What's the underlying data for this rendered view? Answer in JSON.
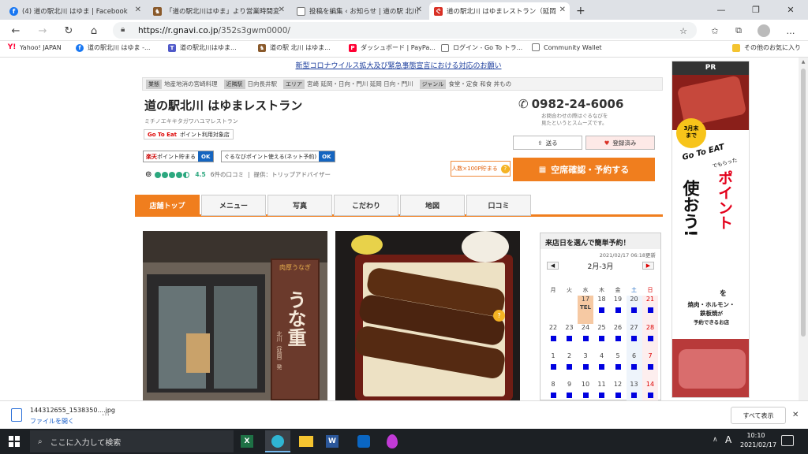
{
  "browser": {
    "tabs": [
      {
        "label": "(4) 道の駅北川 はゆま | Facebook",
        "icon": "facebook-icon",
        "color": "#1877f2"
      },
      {
        "label": "「道の駅北川はゆま」より営業時間変",
        "icon": "horse-icon",
        "color": "#8a5a2b"
      },
      {
        "label": "投稿を編集 ‹ お知らせ | 道の駅 北川",
        "icon": "document-icon",
        "color": "#555555"
      },
      {
        "label": "道の駅北川 はゆまレストラン（延岡",
        "icon": "gnavi-icon",
        "color": "#d93025"
      }
    ],
    "new_tab": "+",
    "url": "https://r.gnavi.co.jp/352s3gwm0000/",
    "url_host": "https://r.gnavi.co.jp",
    "url_path": "/352s3gwm0000/",
    "bookmarks": [
      {
        "label": "Yahoo! JAPAN",
        "icon": "yahoo-icon",
        "color": "#ff0033"
      },
      {
        "label": "道の駅北川 はゆま -...",
        "icon": "facebook-icon",
        "color": "#1877f2"
      },
      {
        "label": "道の駅北川はゆま...",
        "icon": "teams-icon",
        "color": "#5059c9"
      },
      {
        "label": "道の駅 北川 はゆま...",
        "icon": "horse-icon",
        "color": "#8a5a2b"
      },
      {
        "label": "ダッシュボード | PayPa...",
        "icon": "paypay-icon",
        "color": "#ff0033"
      },
      {
        "label": "ログイン - Go To トラ...",
        "icon": "document-icon",
        "color": "#555555"
      },
      {
        "label": "Community Wallet",
        "icon": "document-icon",
        "color": "#555555"
      }
    ],
    "other_bookmarks": "その他のお気に入り"
  },
  "page": {
    "notice": "新型コロナウイルス拡大及び緊急事態宣言における対応のお願い",
    "info": [
      {
        "tag": "業態",
        "value": "地産地消の宮崎料理"
      },
      {
        "tag": "近隣駅",
        "value": "日向長井駅"
      },
      {
        "tag": "エリア",
        "value": "宮崎 延岡・日向・門川 延岡 日向・門川"
      },
      {
        "tag": "ジャンル",
        "value": "食堂・定食 和食 丼もの"
      }
    ],
    "title": "道の駅北川 はゆまレストラン",
    "kana": "ミチノエキキタガワハユマレストラン",
    "goto_eat": "Go To Eat",
    "goto_eat_note": "ポイント利用対象店",
    "rakuten_prefix": "楽天",
    "rakuten_label": "ポイント貯まる",
    "gnavi_point_label": "ぐるなびポイント使える(ネット予約)",
    "ok": "OK",
    "rating_score": "4.5",
    "review_count": "6件の口コミ",
    "review_source": "提供：トリップアドバイザー",
    "phone": "0982-24-6006",
    "phone_note": "お問合わせの際はぐるなびを見たというとスムーズです。",
    "send_label": "送る",
    "saved_label": "登録済み",
    "bonus_label": "人数×100P貯まる",
    "bonus_help": "?",
    "reserve_label": "空席確認・予約する",
    "nav": [
      "店舗トップ",
      "メニュー",
      "写真",
      "こだわり",
      "地図",
      "口コミ"
    ],
    "photo_banner_small": "肉厚うなぎ",
    "photo_banner_big": "うな重",
    "photo_banner_sub": "北川（延岡）発",
    "calendar": {
      "heading": "来店日を選んで簡単予約！",
      "updated": "2021/02/17 06:18更新",
      "month": "2月-3月",
      "prev": "◀",
      "next": "▶",
      "days": [
        "月",
        "火",
        "水",
        "木",
        "金",
        "土",
        "日"
      ],
      "rows": [
        [
          "",
          "",
          "17",
          "18",
          "19",
          "20",
          "21"
        ],
        [
          "22",
          "23",
          "24",
          "25",
          "26",
          "27",
          "28"
        ],
        [
          "1",
          "2",
          "3",
          "4",
          "5",
          "6",
          "7"
        ],
        [
          "8",
          "9",
          "10",
          "11",
          "12",
          "13",
          "14"
        ]
      ],
      "tel": "TEL"
    },
    "ad": {
      "pr": "PR",
      "badge_top": "3月末",
      "badge_bottom": "まで",
      "goto": "Go To EAT",
      "goto_sub": "でもらった",
      "big1": "ポイント",
      "big2": "使おう!",
      "wo": "を",
      "line1": "焼肉・ホルモン・",
      "line2": "鉄板焼",
      "line2b": "が",
      "line3": "予約できるお店"
    }
  },
  "download": {
    "filename": "144312655_1538350....jpg",
    "open_label": "ファイルを開く",
    "show_all": "すべて表示"
  },
  "taskbar": {
    "search_placeholder": "ここに入力して検索",
    "time": "10:10",
    "date": "2021/02/17",
    "ime": "A"
  }
}
